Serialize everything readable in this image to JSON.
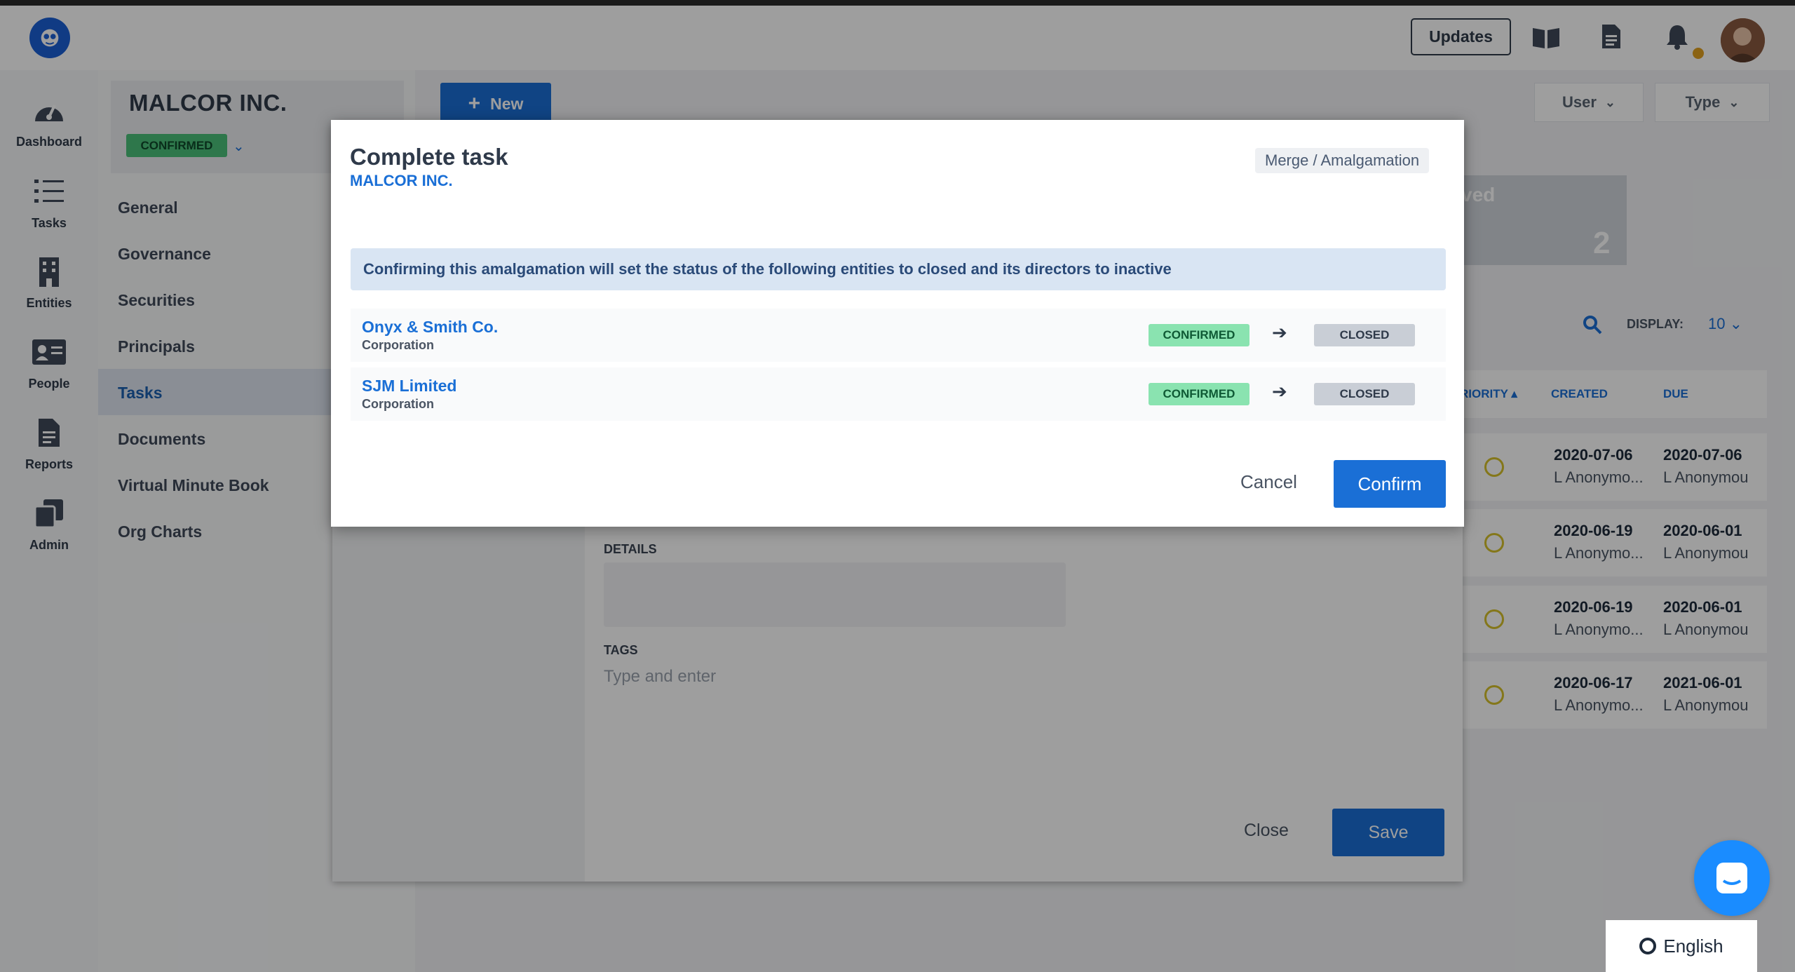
{
  "topbar": {
    "updates_label": "Updates",
    "icons": [
      "logo-icon",
      "book-icon",
      "document-icon",
      "bell-icon",
      "avatar"
    ]
  },
  "nav": {
    "items": [
      {
        "label": "Dashboard",
        "icon": "gauge-icon"
      },
      {
        "label": "Tasks",
        "icon": "list-icon"
      },
      {
        "label": "Entities",
        "icon": "building-icon"
      },
      {
        "label": "People",
        "icon": "id-card-icon"
      },
      {
        "label": "Reports",
        "icon": "report-icon"
      },
      {
        "label": "Admin",
        "icon": "copy-icon"
      }
    ]
  },
  "entity": {
    "name": "MALCOR INC.",
    "status": "CONFIRMED"
  },
  "entity_menu": {
    "items": [
      "General",
      "Governance",
      "Securities",
      "Principals",
      "Tasks",
      "Documents",
      "Virtual Minute Book",
      "Org Charts"
    ],
    "active": "Tasks"
  },
  "main": {
    "new_label": "New",
    "user_filter": "User",
    "type_filter": "Type",
    "stat_label": "ved",
    "stat_value": "2",
    "display_label": "DISPLAY:",
    "display_value": "10",
    "columns": [
      "RIORITY",
      "CREATED",
      "DUE"
    ],
    "rows": [
      {
        "created": "2020-07-06",
        "created_by": "L Anonymo...",
        "due": "2020-07-06",
        "due_by": "L Anonymou"
      },
      {
        "created": "2020-06-19",
        "created_by": "L Anonymo...",
        "due": "2020-06-01",
        "due_by": "L Anonymou"
      },
      {
        "created": "2020-06-19",
        "created_by": "L Anonymo...",
        "due": "2020-06-01",
        "due_by": "L Anonymou"
      },
      {
        "created": "2020-06-17",
        "created_by": "L Anonymo...",
        "due": "2021-06-01",
        "due_by": "L Anonymou"
      }
    ]
  },
  "task_sheet": {
    "details_label": "DETAILS",
    "tags_label": "TAGS",
    "tags_placeholder": "Type and enter",
    "close_label": "Close",
    "save_label": "Save"
  },
  "modal": {
    "title": "Complete task",
    "subtitle": "MALCOR INC.",
    "tag": "Merge / Amalgamation",
    "banner": "Confirming this amalgamation will set the status of the following entities to closed and its directors to inactive",
    "entities": [
      {
        "name": "Onyx & Smith Co.",
        "type": "Corporation",
        "from": "CONFIRMED",
        "to": "CLOSED"
      },
      {
        "name": "SJM Limited",
        "type": "Corporation",
        "from": "CONFIRMED",
        "to": "CLOSED"
      }
    ],
    "cancel_label": "Cancel",
    "confirm_label": "Confirm"
  },
  "language": {
    "label": "English"
  },
  "colors": {
    "accent": "#1a6fd6",
    "confirmed": "#8ae3b0",
    "closed": "#c9ced6"
  }
}
